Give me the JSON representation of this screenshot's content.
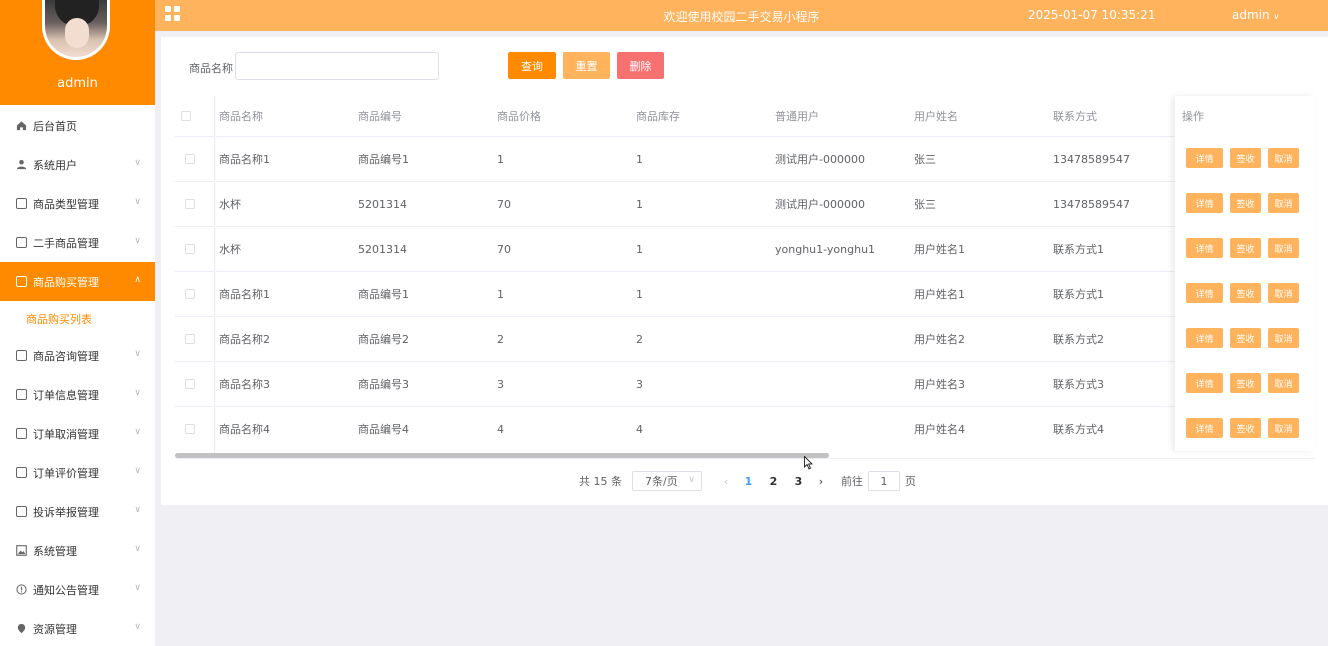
{
  "sidebar": {
    "profile_name": "admin",
    "items": [
      {
        "label": "后台首页",
        "icon": "home-icon"
      },
      {
        "label": "系统用户",
        "icon": "user-icon"
      },
      {
        "label": "商品类型管理",
        "icon": "doc-icon"
      },
      {
        "label": "二手商品管理",
        "icon": "doc-icon"
      },
      {
        "label": "商品购买管理",
        "icon": "doc-icon"
      },
      {
        "label": "商品咨询管理",
        "icon": "doc-icon"
      },
      {
        "label": "订单信息管理",
        "icon": "doc-icon"
      },
      {
        "label": "订单取消管理",
        "icon": "doc-icon"
      },
      {
        "label": "订单评价管理",
        "icon": "doc-icon"
      },
      {
        "label": "投诉举报管理",
        "icon": "doc-icon"
      },
      {
        "label": "系统管理",
        "icon": "image-icon"
      },
      {
        "label": "通知公告管理",
        "icon": "info-icon"
      },
      {
        "label": "资源管理",
        "icon": "location-icon"
      }
    ],
    "sub_item": "商品购买列表",
    "active_color": "#ff8a00"
  },
  "header": {
    "welcome": "欢迎使用校园二手交易小程序",
    "datetime": "2025-01-07 10:35:21",
    "user": "admin"
  },
  "search": {
    "label": "商品名称",
    "value": "",
    "query_label": "查询",
    "reset_label": "重置",
    "delete_label": "删除"
  },
  "table": {
    "columns": [
      "商品名称",
      "商品编号",
      "商品价格",
      "商品库存",
      "普通用户",
      "用户姓名",
      "联系方式",
      "操作"
    ],
    "rows": [
      [
        "商品名称1",
        "商品编号1",
        "1",
        "1",
        "测试用户-000000",
        "张三",
        "13478589547"
      ],
      [
        "水杯",
        "5201314",
        "70",
        "1",
        "测试用户-000000",
        "张三",
        "13478589547"
      ],
      [
        "水杯",
        "5201314",
        "70",
        "1",
        "yonghu1-yonghu1",
        "用户姓名1",
        "联系方式1"
      ],
      [
        "商品名称1",
        "商品编号1",
        "1",
        "1",
        "",
        "用户姓名1",
        "联系方式1"
      ],
      [
        "商品名称2",
        "商品编号2",
        "2",
        "2",
        "",
        "用户姓名2",
        "联系方式2"
      ],
      [
        "商品名称3",
        "商品编号3",
        "3",
        "3",
        "",
        "用户姓名3",
        "联系方式3"
      ],
      [
        "商品名称4",
        "商品编号4",
        "4",
        "4",
        "",
        "用户姓名4",
        "联系方式4"
      ]
    ],
    "actions": [
      "详情",
      "签收",
      "取消"
    ]
  },
  "pagination": {
    "total": "共 15 条",
    "page_size": "7条/页",
    "pages": [
      "1",
      "2",
      "3"
    ],
    "current": "1",
    "goto_label": "前往",
    "goto_value": "1",
    "page_suffix": "页"
  }
}
